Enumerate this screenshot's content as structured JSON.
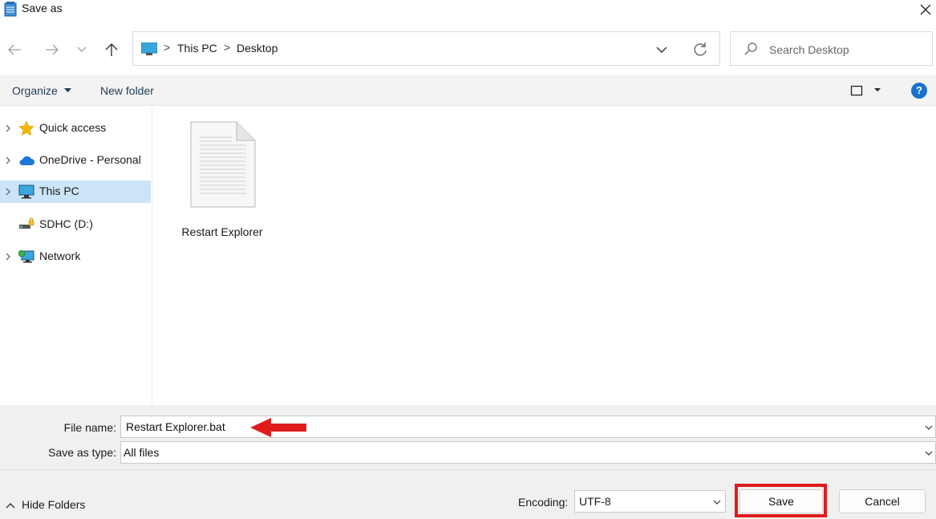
{
  "window": {
    "title": "Save as",
    "app_icon": "notepad-icon",
    "close_icon": "close-icon"
  },
  "navigation": {
    "back_icon": "back-arrow-icon",
    "forward_icon": "forward-arrow-icon",
    "recent_icon": "chevron-down-icon",
    "up_icon": "up-arrow-icon",
    "breadcrumb": [
      "This PC",
      "Desktop"
    ],
    "breadcrumb_separator": ">",
    "search_placeholder": "Search Desktop"
  },
  "toolbar": {
    "organize_label": "Organize",
    "new_folder_label": "New folder",
    "help_label": "?"
  },
  "sidebar": {
    "items": [
      {
        "label": "Quick access",
        "icon": "star-icon",
        "expandable": true,
        "selected": false
      },
      {
        "label": "OneDrive - Personal",
        "icon": "cloud-icon",
        "expandable": true,
        "selected": false
      },
      {
        "label": "This PC",
        "icon": "computer-icon",
        "expandable": true,
        "selected": true
      },
      {
        "label": "SDHC (D:)",
        "icon": "drive-icon",
        "expandable": false,
        "selected": false
      },
      {
        "label": "Network",
        "icon": "network-icon",
        "expandable": true,
        "selected": false
      }
    ]
  },
  "content": {
    "files": [
      {
        "name": "Restart Explorer",
        "icon": "text-file-icon"
      }
    ]
  },
  "form": {
    "file_name_label": "File name:",
    "file_name_value": "Restart Explorer.bat",
    "save_as_type_label": "Save as type:",
    "save_as_type_value": "All files",
    "encoding_label": "Encoding:",
    "encoding_value": "UTF-8",
    "hide_folders_label": "Hide Folders",
    "save_label": "Save",
    "cancel_label": "Cancel"
  },
  "annotations": {
    "highlight_color": "#e01b1b",
    "arrow_color": "#e01b1b"
  }
}
